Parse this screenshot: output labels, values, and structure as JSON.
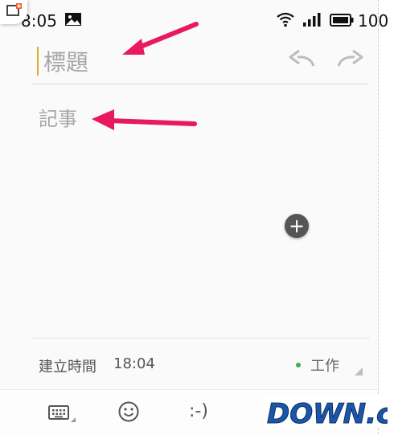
{
  "status_bar": {
    "time": "8:05",
    "battery": "100"
  },
  "editor": {
    "title_placeholder": "標題",
    "body_placeholder": "記事"
  },
  "footer": {
    "created_label": "建立時間",
    "created_time": "18:04",
    "category": "工作",
    "category_color": "#3fae5b"
  },
  "toolbar": {
    "emoticon": ":-)"
  },
  "watermark": {
    "text": "DOWN.cc"
  },
  "annotations": {
    "arrow_color": "#e8195f"
  },
  "accent_color": "#e2a92b"
}
